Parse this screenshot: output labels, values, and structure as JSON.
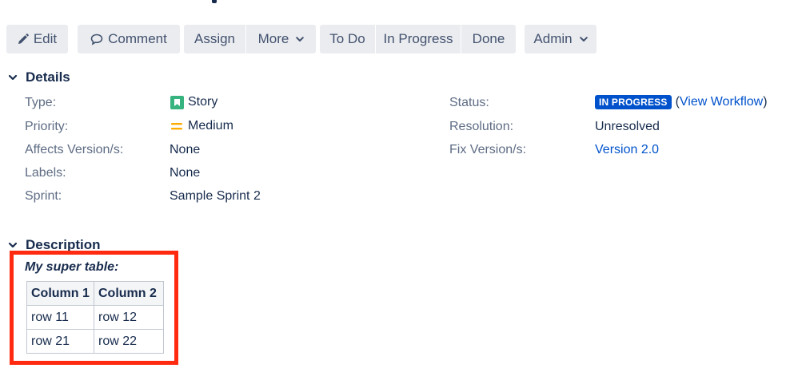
{
  "toolbar": {
    "edit": "Edit",
    "comment": "Comment",
    "assign": "Assign",
    "more": "More",
    "todo": "To Do",
    "in_progress": "In Progress",
    "done": "Done",
    "admin": "Admin"
  },
  "details": {
    "title": "Details",
    "type_label": "Type:",
    "type_value": "Story",
    "priority_label": "Priority:",
    "priority_value": "Medium",
    "affects_label": "Affects Version/s:",
    "affects_value": "None",
    "labels_label": "Labels:",
    "labels_value": "None",
    "sprint_label": "Sprint:",
    "sprint_value": "Sample Sprint 2",
    "status_label": "Status:",
    "status_value": "IN PROGRESS",
    "view_workflow_open": "(",
    "view_workflow": "View Workflow",
    "view_workflow_close": ")",
    "resolution_label": "Resolution:",
    "resolution_value": "Unresolved",
    "fix_label": "Fix Version/s:",
    "fix_value": "Version 2.0"
  },
  "description": {
    "title": "Description",
    "table_caption": "My super table:",
    "table": {
      "headers": [
        "Column 1",
        "Column 2"
      ],
      "rows": [
        [
          "row 11",
          "row 12"
        ],
        [
          "row 21",
          "row 22"
        ]
      ]
    }
  },
  "colors": {
    "story_icon": "#36b37e",
    "priority_medium": "#ffab00",
    "status_lozenge": "#0052cc",
    "highlight_border": "#ff2a10"
  },
  "icons": {
    "edit": "pencil-icon",
    "comment": "speech-bubble-icon",
    "dropdown": "chevron-down-icon",
    "section": "chevron-down-icon",
    "story": "bookmark-icon",
    "priority": "equals-icon"
  }
}
